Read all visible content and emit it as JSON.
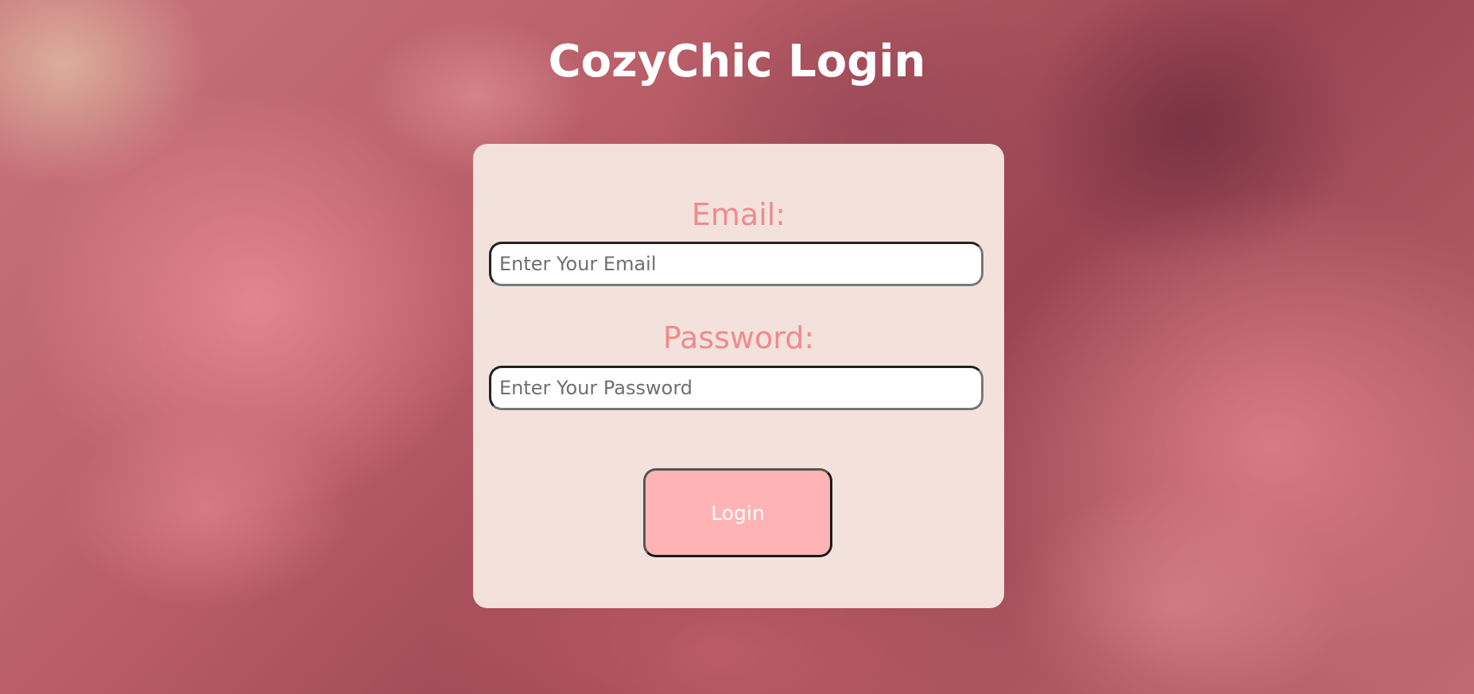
{
  "page": {
    "title": "CozyChic Login"
  },
  "form": {
    "email_label": "Email:",
    "email_placeholder": "Enter Your Email",
    "email_value": "",
    "password_label": "Password:",
    "password_placeholder": "Enter Your Password",
    "password_value": "",
    "login_label": "Login"
  },
  "colors": {
    "card_background": "#f3e2dc",
    "label_color": "#f08a8e",
    "button_background": "#ffb3b5",
    "title_color": "#ffffff"
  }
}
